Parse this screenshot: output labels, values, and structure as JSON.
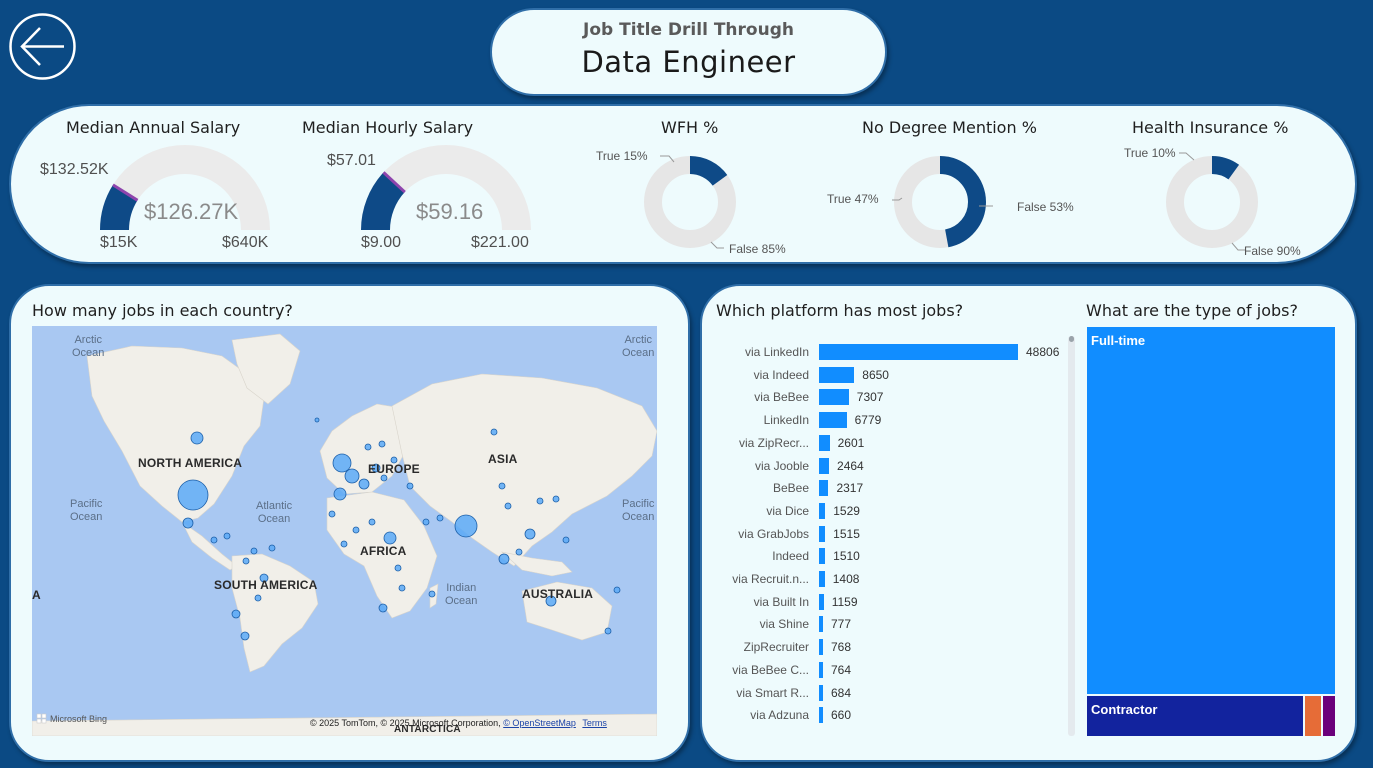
{
  "header": {
    "subtitle": "Job Title Drill Through",
    "title": "Data Engineer"
  },
  "kpis": {
    "annual": {
      "title": "Median Annual Salary",
      "value": "$126.27K",
      "min": "$15K",
      "max": "$640K",
      "target": "$132.52K",
      "fraction": 0.178
    },
    "hourly": {
      "title": "Median Hourly Salary",
      "value": "$59.16",
      "min": "$9.00",
      "max": "$221.00",
      "target": "$57.01",
      "fraction": 0.237
    },
    "wfh": {
      "title": "WFH %",
      "true_label": "True 15%",
      "false_label": "False 85%",
      "true_fraction": 0.15
    },
    "no_degree": {
      "title": "No Degree Mention %",
      "true_label": "True 47%",
      "false_label": "False 53%",
      "true_fraction": 0.47
    },
    "health": {
      "title": "Health Insurance %",
      "true_label": "True 10%",
      "false_label": "False 90%",
      "true_fraction": 0.1
    }
  },
  "map": {
    "title": "How many jobs in each country?",
    "oceans": {
      "arctic_left": "Arctic\nOcean",
      "arctic_right": "Arctic\nOcean",
      "pacific_left": "Pacific\nOcean",
      "atlantic": "Atlantic\nOcean",
      "pacific_right": "Pacific\nOcean",
      "indian": "Indian\nOcean"
    },
    "continents": {
      "north_america": "NORTH AMERICA",
      "europe": "EUROPE",
      "asia": "ASIA",
      "africa": "AFRICA",
      "south_america": "SOUTH AMERICA",
      "australia": "AUSTRALIA",
      "antarctica": "ANTARCTICA",
      "a_edge": "A"
    },
    "logo": "Microsoft Bing",
    "attribution": "© 2025 TomTom, © 2025 Microsoft Corporation,",
    "osm_link": "© OpenStreetMap",
    "terms_link": "Terms",
    "colors": {
      "land": "#f1efe9",
      "water": "#a9c8f2",
      "bubble": "#5aa9f7"
    }
  },
  "platforms": {
    "title": "Which platform has most jobs?",
    "items": [
      {
        "label": "via LinkedIn",
        "value": 48806
      },
      {
        "label": "via Indeed",
        "value": 8650
      },
      {
        "label": "via BeBee",
        "value": 7307
      },
      {
        "label": "LinkedIn",
        "value": 6779
      },
      {
        "label": "via ZipRecr...",
        "value": 2601
      },
      {
        "label": "via Jooble",
        "value": 2464
      },
      {
        "label": "BeBee",
        "value": 2317
      },
      {
        "label": "via Dice",
        "value": 1529
      },
      {
        "label": "via GrabJobs",
        "value": 1515
      },
      {
        "label": "Indeed",
        "value": 1510
      },
      {
        "label": "via Recruit.n...",
        "value": 1408
      },
      {
        "label": "via Built In",
        "value": 1159
      },
      {
        "label": "via Shine",
        "value": 777
      },
      {
        "label": "ZipRecruiter",
        "value": 768
      },
      {
        "label": "via BeBee C...",
        "value": 764
      },
      {
        "label": "via Smart R...",
        "value": 684
      },
      {
        "label": "via Adzuna",
        "value": 660
      }
    ],
    "max_value": 48806,
    "bar_color": "#118dff"
  },
  "job_types": {
    "title": "What are the type of jobs?",
    "cells": [
      {
        "label": "Full-time",
        "color": "#118dff"
      },
      {
        "label": "Contractor",
        "color": "#12239e"
      },
      {
        "label": "",
        "color": "#e66c37"
      },
      {
        "label": "",
        "color": "#6b007b"
      }
    ]
  }
}
